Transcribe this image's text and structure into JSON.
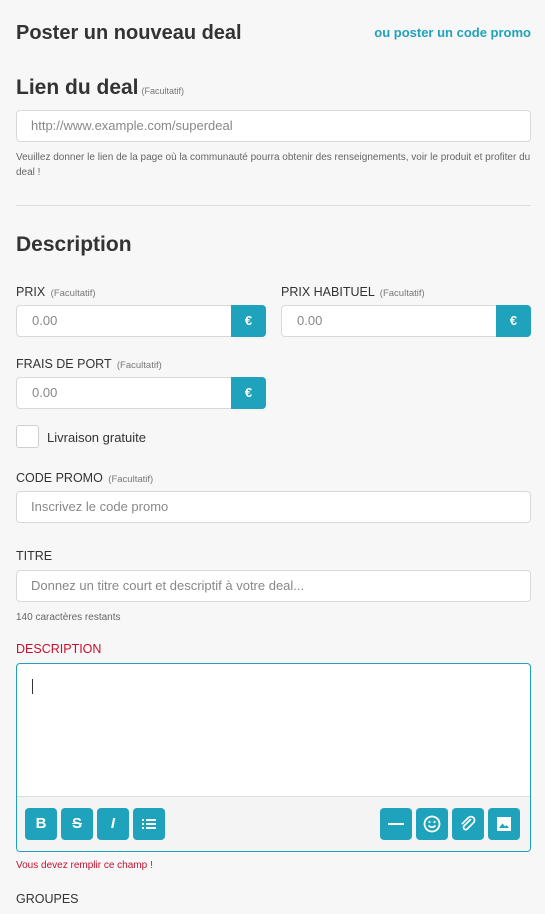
{
  "header": {
    "title": "Poster un nouveau deal",
    "alt_link": "ou poster un code promo"
  },
  "lien": {
    "heading": "Lien du deal",
    "optional": "(Facultatif)",
    "placeholder": "http://www.example.com/superdeal",
    "hint": "Veuillez donner le lien de la page où la communauté pourra obtenir des renseignements, voir le produit et profiter du deal !"
  },
  "description_section": {
    "heading": "Description"
  },
  "prix": {
    "label": "PRIX",
    "optional": "(Facultatif)",
    "value": "0.00",
    "currency": "€"
  },
  "prix_habituel": {
    "label": "PRIX HABITUEL",
    "optional": "(Facultatif)",
    "value": "0.00",
    "currency": "€"
  },
  "frais": {
    "label": "FRAIS DE PORT",
    "optional": "(Facultatif)",
    "value": "0.00",
    "currency": "€"
  },
  "livraison": {
    "label": "Livraison gratuite",
    "checked": false
  },
  "code_promo": {
    "label": "CODE PROMO",
    "optional": "(Facultatif)",
    "placeholder": "Inscrivez le code promo"
  },
  "titre": {
    "label": "TITRE",
    "placeholder": "Donnez un titre court et descriptif à votre deal...",
    "remaining": "140 caractères restants"
  },
  "description": {
    "label": "DESCRIPTION",
    "error": "Vous devez remplir ce champ !",
    "toolbar": {
      "bold": "B",
      "strike": "S",
      "italic": "I"
    }
  },
  "groupes": {
    "label": "GROUPES"
  },
  "colors": {
    "accent": "#1fa2bb",
    "error": "#c8102e"
  }
}
